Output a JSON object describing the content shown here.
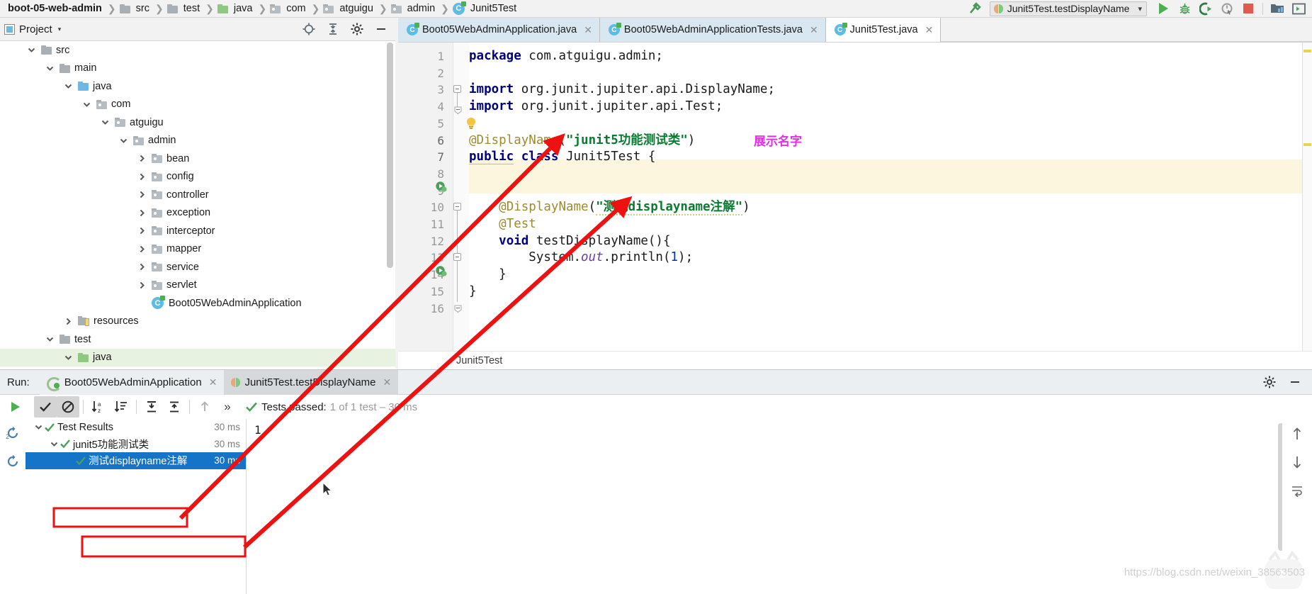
{
  "window": {
    "breadcrumbs": [
      {
        "label": "boot-05-web-admin",
        "icon": "project-icon",
        "bold": true
      },
      {
        "label": "src",
        "icon": "folder-icon"
      },
      {
        "label": "test",
        "icon": "folder-icon"
      },
      {
        "label": "java",
        "icon": "folder-green-icon"
      },
      {
        "label": "com",
        "icon": "package-icon"
      },
      {
        "label": "atguigu",
        "icon": "package-icon"
      },
      {
        "label": "admin",
        "icon": "package-icon"
      },
      {
        "label": "Junit5Test",
        "icon": "java-class-icon"
      }
    ],
    "toolbar": {
      "build_label": "build-hammer-icon",
      "run_config": "Junit5Test.testDisplayName",
      "run_label": "run-button",
      "debug_label": "debug-button",
      "coverage_label": "run-with-coverage-button",
      "profile_label": "profile-button",
      "stop_label": "stop-button",
      "more1_label": "open-project-structure-button",
      "more2_label": "terminal-button"
    }
  },
  "project_panel": {
    "title": "Project",
    "caret": "▾",
    "actions": [
      "locate-icon",
      "collapse-all-icon",
      "settings-icon",
      "hide-icon"
    ],
    "tree": [
      {
        "label": "src",
        "indent": 1,
        "state": "expanded",
        "icon": "folder-icon"
      },
      {
        "label": "main",
        "indent": 2,
        "state": "expanded",
        "icon": "folder-icon"
      },
      {
        "label": "java",
        "indent": 3,
        "state": "expanded",
        "icon": "folder-source-icon"
      },
      {
        "label": "com",
        "indent": 4,
        "state": "expanded",
        "icon": "package-icon"
      },
      {
        "label": "atguigu",
        "indent": 5,
        "state": "expanded",
        "icon": "package-icon"
      },
      {
        "label": "admin",
        "indent": 6,
        "state": "expanded",
        "icon": "package-icon"
      },
      {
        "label": "bean",
        "indent": 7,
        "state": "collapsed",
        "icon": "package-icon"
      },
      {
        "label": "config",
        "indent": 7,
        "state": "collapsed",
        "icon": "package-icon"
      },
      {
        "label": "controller",
        "indent": 7,
        "state": "collapsed",
        "icon": "package-icon"
      },
      {
        "label": "exception",
        "indent": 7,
        "state": "collapsed",
        "icon": "package-icon"
      },
      {
        "label": "interceptor",
        "indent": 7,
        "state": "collapsed",
        "icon": "package-icon"
      },
      {
        "label": "mapper",
        "indent": 7,
        "state": "collapsed",
        "icon": "package-icon"
      },
      {
        "label": "service",
        "indent": 7,
        "state": "collapsed",
        "icon": "package-icon"
      },
      {
        "label": "servlet",
        "indent": 7,
        "state": "collapsed",
        "icon": "package-icon"
      },
      {
        "label": "Boot05WebAdminApplication",
        "indent": 7,
        "state": "leaf",
        "icon": "java-class-icon"
      },
      {
        "label": "resources",
        "indent": 3,
        "state": "collapsed",
        "icon": "resources-folder-icon"
      },
      {
        "label": "test",
        "indent": 2,
        "state": "expanded",
        "icon": "folder-icon"
      },
      {
        "label": "java",
        "indent": 3,
        "state": "expanded",
        "icon": "folder-test-source-icon",
        "highlighted": true
      }
    ]
  },
  "editor": {
    "tabs": [
      {
        "label": "Boot05WebAdminApplication.java",
        "active": false,
        "closable": true
      },
      {
        "label": "Boot05WebAdminApplicationTests.java",
        "active": false,
        "closable": true
      },
      {
        "label": "Junit5Test.java",
        "active": true,
        "closable": true
      }
    ],
    "breadcrumb": "Junit5Test",
    "lines": [
      {
        "n": 1,
        "text": "package com.atguigu.admin;"
      },
      {
        "n": 2,
        "text": ""
      },
      {
        "n": 3,
        "text": "import org.junit.jupiter.api.DisplayName;"
      },
      {
        "n": 4,
        "text": "import org.junit.jupiter.api.Test;"
      },
      {
        "n": 5,
        "text": ""
      },
      {
        "n": 6,
        "text": "@DisplayName(\"junit5功能测试类\")"
      },
      {
        "n": 7,
        "text": "public class Junit5Test {"
      },
      {
        "n": 8,
        "text": ""
      },
      {
        "n": 9,
        "text": ""
      },
      {
        "n": 10,
        "text": "    @DisplayName(\"测试displayname注解\")"
      },
      {
        "n": 11,
        "text": "    @Test"
      },
      {
        "n": 12,
        "text": "    void testDisplayName(){"
      },
      {
        "n": 13,
        "text": "        System.out.println(1);"
      },
      {
        "n": 14,
        "text": "    }"
      },
      {
        "n": 15,
        "text": "}"
      },
      {
        "n": 16,
        "text": ""
      }
    ],
    "annotation_note": "展示名字"
  },
  "run_panel": {
    "run_label": "Run:",
    "tabs": [
      {
        "label": "Boot05WebAdminApplication",
        "active": false,
        "icon": "spring-boot-icon"
      },
      {
        "label": "Junit5Test.testDisplayName",
        "active": true,
        "icon": "junit-icon"
      }
    ],
    "toolbar": {
      "rerun": "rerun-icon",
      "show_passed": "show-passed-toggle",
      "show_ignored": "show-ignored-toggle",
      "sort_alpha": "sort-alphabetically-icon",
      "sort_duration": "sort-by-duration-icon",
      "expand_all": "expand-all-icon",
      "collapse_all": "collapse-all-icon",
      "prev_fail": "previous-failed-test-icon",
      "more": "»",
      "settings": "settings-gear-icon",
      "hide": "hide-panel-icon"
    },
    "status": {
      "text": "Tests passed:",
      "detail": "1 of 1 test – 30 ms"
    },
    "results": [
      {
        "label": "Test Results",
        "time": "30 ms",
        "indent": 0,
        "state": "expanded",
        "selected": false
      },
      {
        "label": "junit5功能测试类",
        "time": "30 ms",
        "indent": 1,
        "state": "expanded",
        "selected": false
      },
      {
        "label": "测试displayname注解",
        "time": "30 ms",
        "indent": 2,
        "state": "leaf",
        "selected": true
      }
    ],
    "console_output": "1"
  },
  "watermark": "https://blog.csdn.net/weixin_38563503",
  "colors": {
    "accent_blue": "#1574c8",
    "annotation_red": "#ee1111",
    "annotation_magenta": "#e52ee5",
    "success_green": "#4caf50",
    "string_green": "#0a7c32",
    "keyword_blue": "#000080",
    "annotation_gold": "#9e8a2e"
  }
}
